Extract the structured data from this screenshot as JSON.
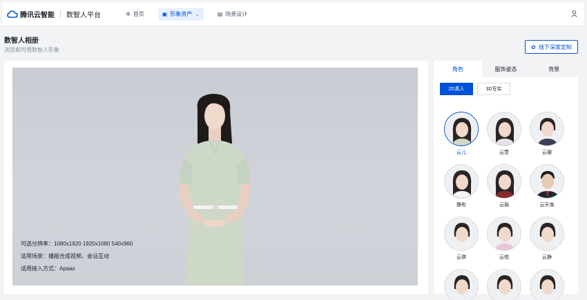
{
  "header": {
    "logo_text": "腾讯云智能",
    "platform": "数智人平台",
    "nav": [
      {
        "icon": "gear-icon",
        "label": "首页"
      },
      {
        "icon": "image-icon",
        "label": "形象资产",
        "active": true
      },
      {
        "icon": "video-icon",
        "label": "场景设计"
      }
    ],
    "user_icon": "user-icon"
  },
  "page": {
    "title": "数智人相册",
    "subtitle": "浏览和可用数智人形象",
    "custom_button": "线下深度定制"
  },
  "preview": {
    "info": [
      "可选分辨率：1080x1920 1920x1080 540x960",
      "适用场景：播报合成视频、会话互动",
      "适用接入方式：Apaas"
    ]
  },
  "right": {
    "tabs": [
      "角色",
      "服饰姿态",
      "背景"
    ],
    "subtabs": [
      "2D真人",
      "3D写实"
    ],
    "avatars": [
      {
        "name": "云儿",
        "selected": true
      },
      {
        "name": "云萱"
      },
      {
        "name": "云珊"
      },
      {
        "name": "静彤"
      },
      {
        "name": "云瑜"
      },
      {
        "name": "云天逸"
      },
      {
        "name": "云琪"
      },
      {
        "name": "云悦"
      },
      {
        "name": "云静"
      },
      {
        "name": ""
      },
      {
        "name": ""
      },
      {
        "name": ""
      }
    ]
  },
  "colors": {
    "accent": "#0052d9",
    "background": "#f2f3f5"
  }
}
